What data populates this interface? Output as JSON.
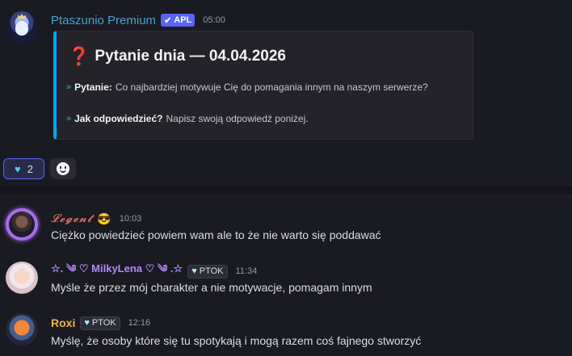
{
  "bot_message": {
    "author": "Ptaszunio Premium",
    "badge": "APL",
    "time": "05:00",
    "embed": {
      "title": "Pytanie dnia — 04.04.2026",
      "fields": [
        {
          "label": "Pytanie:",
          "text": "Co najbardziej motywuje Cię do pomagania innym na naszym serwerze?"
        },
        {
          "label": "Jak odpowiedzieć?",
          "text": "Napisz swoją odpowiedź poniżej."
        }
      ]
    },
    "reaction": {
      "icon": "heart-icon",
      "count": "2"
    }
  },
  "messages": [
    {
      "author": "𝓛𝓮𝓰𝓮𝓷𝓽",
      "emoji": "😎",
      "time": "10:03",
      "text": "Ciężko powiedzieć powiem wam ale to że nie warto się poddawać"
    },
    {
      "author": "☆. ༄ ♡ MilkyLena ♡ ༄ .☆",
      "role": "PTOK",
      "time": "11:34",
      "text": "Myśle że przez mój charakter a nie motywacje, pomagam innym"
    },
    {
      "author": "Roxi",
      "role": "PTOK",
      "time": "12:16",
      "text": "Myślę, że osoby które się tu spotykają i mogą razem coś fajnego stworzyć"
    }
  ],
  "colors": {
    "background": "#1a1a22",
    "embed_accent": "#00a8fc",
    "app_badge": "#5865f2",
    "bot_name": "#4aa0c8",
    "legent_name": "#f07a70",
    "milky_name": "#b388ff",
    "roxi_name": "#f0b24a"
  }
}
